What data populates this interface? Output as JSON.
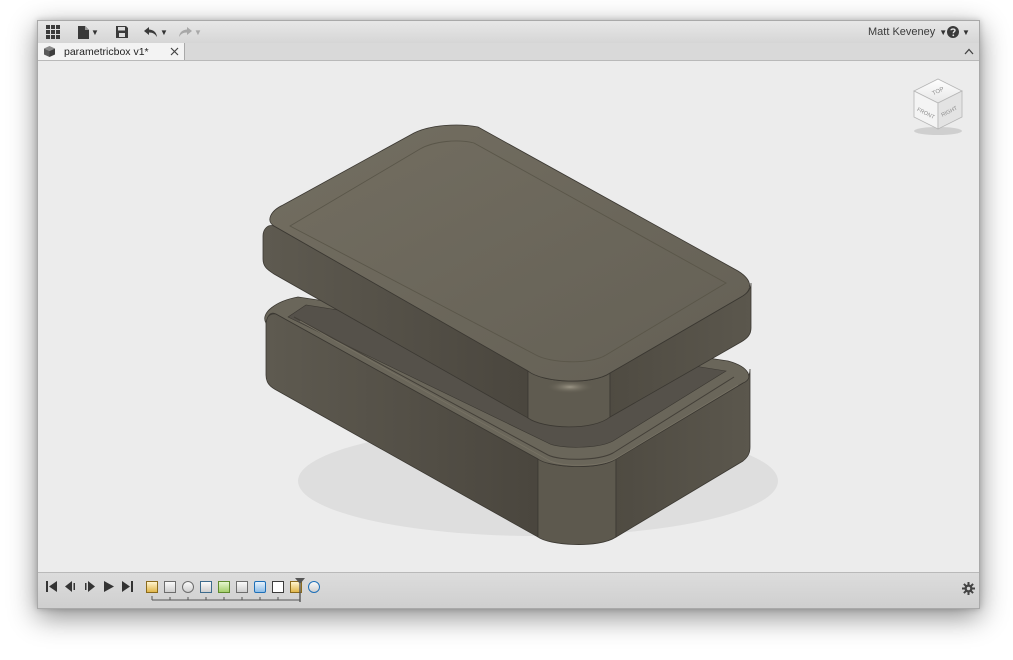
{
  "toolbar": {
    "user_name": "Matt Keveney",
    "icons": [
      "grid-icon",
      "file-icon",
      "save-icon",
      "undo-icon",
      "redo-icon",
      "help-icon"
    ]
  },
  "tabs": [
    {
      "label": "parametricbox v1*",
      "active": true
    }
  ],
  "viewcube": {
    "top": "TOP",
    "front": "FRONT",
    "right": "RIGHT"
  },
  "timeline": {
    "playback": [
      "first",
      "previous",
      "play",
      "next",
      "last"
    ],
    "features": [
      "sketch",
      "extrude",
      "fillet",
      "shell",
      "split",
      "combine",
      "split-body",
      "move",
      "sketch",
      "fillet"
    ]
  },
  "colors": {
    "model_top": "#6b6659",
    "model_side": "#4f4b42",
    "background": "#ececec",
    "toolbar": "#dcdcdc"
  }
}
